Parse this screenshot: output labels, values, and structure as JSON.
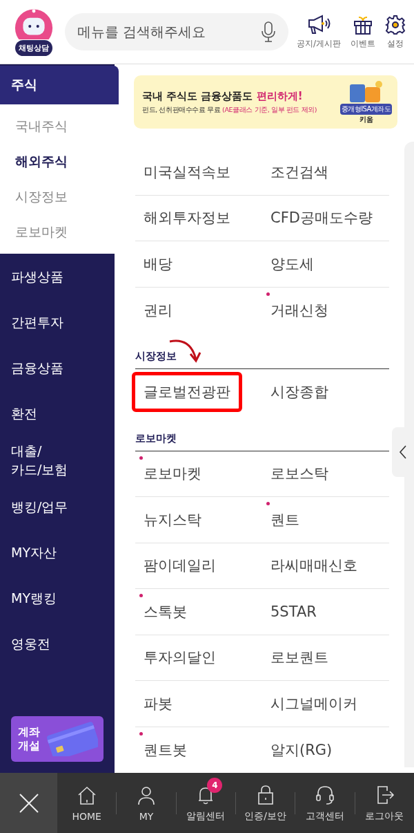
{
  "header": {
    "chat_label": "채팅상담",
    "search": {
      "placeholder": "메뉴를 검색해주세요"
    },
    "actions": [
      {
        "kind": "notice",
        "label": "공지/게시판"
      },
      {
        "kind": "event",
        "label": "이벤트"
      },
      {
        "kind": "settings",
        "label": "설정"
      }
    ]
  },
  "sidebar": {
    "items": [
      {
        "label": "주식",
        "selected": true,
        "children": [
          {
            "label": "국내주식",
            "selected": false
          },
          {
            "label": "해외주식",
            "selected": true
          },
          {
            "label": "시장정보",
            "selected": false
          },
          {
            "label": "로보마켓",
            "selected": false
          }
        ]
      },
      {
        "label": "파생상품",
        "selected": false
      },
      {
        "label": "간편투자",
        "selected": false
      },
      {
        "label": "금융상품",
        "selected": false
      },
      {
        "label": "환전",
        "selected": false
      },
      {
        "label": "대출/\n카드/보험",
        "selected": false
      },
      {
        "label": "뱅킹/업무",
        "selected": false
      },
      {
        "label": "MY자산",
        "selected": false
      },
      {
        "label": "MY랭킹",
        "selected": false
      },
      {
        "label": "영웅전",
        "selected": false
      }
    ],
    "promo": "계좌\n개설"
  },
  "banner": {
    "headline": "국내 주식도 금융상품도 ",
    "headline_accent": "편리하게!",
    "subline": "펀드, 선취판매수수료 무료 ",
    "subline_accent": "(AE클래스 기준, 일부 펀드 제외)",
    "badge": "중개형ISA계좌도",
    "badge_brand": "키움"
  },
  "sections": [
    {
      "rows": [
        [
          {
            "label": "미국실적속보",
            "new": false,
            "highlighted": false
          },
          {
            "label": "조건검색",
            "new": false,
            "highlighted": false
          }
        ],
        [
          {
            "label": "해외투자정보",
            "new": false,
            "highlighted": false
          },
          {
            "label": "CFD공매도수량",
            "new": false,
            "highlighted": false
          }
        ],
        [
          {
            "label": "배당",
            "new": false,
            "highlighted": false
          },
          {
            "label": "양도세",
            "new": false,
            "highlighted": false
          }
        ],
        [
          {
            "label": "권리",
            "new": false,
            "highlighted": false
          },
          {
            "label": "거래신청",
            "new": true,
            "highlighted": false
          }
        ]
      ]
    },
    {
      "title": "시장정보",
      "arrow": true,
      "rows": [
        [
          {
            "label": "글로벌전광판",
            "new": false,
            "highlighted": true
          },
          {
            "label": "시장종합",
            "new": false,
            "highlighted": false
          }
        ]
      ]
    },
    {
      "title": "로보마켓",
      "rows": [
        [
          {
            "label": "로보마켓",
            "new": true,
            "highlighted": false
          },
          {
            "label": "로보스탁",
            "new": false,
            "highlighted": false
          }
        ],
        [
          {
            "label": "뉴지스탁",
            "new": false,
            "highlighted": false
          },
          {
            "label": "퀀트",
            "new": true,
            "highlighted": false
          }
        ],
        [
          {
            "label": "팜이데일리",
            "new": false,
            "highlighted": false
          },
          {
            "label": "라씨매매신호",
            "new": false,
            "highlighted": false
          }
        ],
        [
          {
            "label": "스톡봇",
            "new": true,
            "highlighted": false
          },
          {
            "label": "5STAR",
            "new": false,
            "highlighted": false
          }
        ],
        [
          {
            "label": "투자의달인",
            "new": false,
            "highlighted": false
          },
          {
            "label": "로보퀀트",
            "new": false,
            "highlighted": false
          }
        ],
        [
          {
            "label": "파봇",
            "new": false,
            "highlighted": false
          },
          {
            "label": "시그널메이커",
            "new": false,
            "highlighted": false
          }
        ],
        [
          {
            "label": "퀀트봇",
            "new": true,
            "highlighted": false
          },
          {
            "label": "알지(RG)",
            "new": false,
            "highlighted": false
          }
        ]
      ]
    }
  ],
  "bottom_nav": [
    {
      "kind": "home",
      "label": "HOME"
    },
    {
      "kind": "user",
      "label": "MY"
    },
    {
      "kind": "bell",
      "label": "알림센터",
      "badge": "4"
    },
    {
      "kind": "lock",
      "label": "인증/보안"
    },
    {
      "kind": "headset",
      "label": "고객센터"
    },
    {
      "kind": "logout",
      "label": "로그아웃"
    }
  ]
}
